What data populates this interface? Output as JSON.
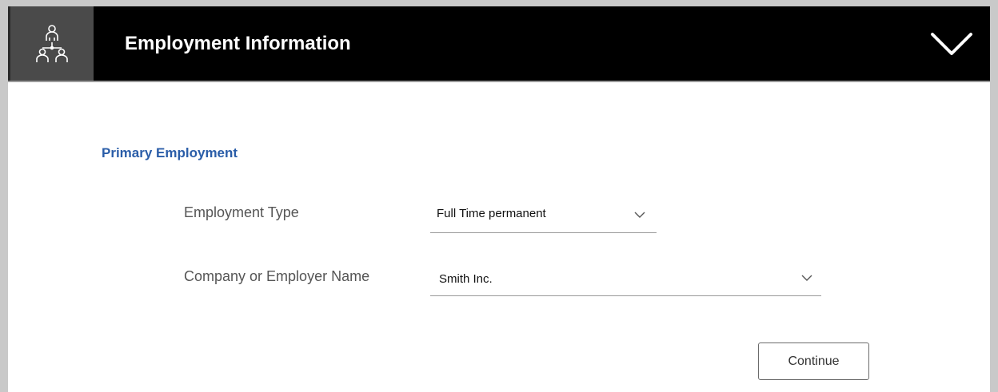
{
  "header": {
    "icon": "org-chart-icon",
    "title": "Employment Information",
    "toggle_icon": "chevron-down-icon"
  },
  "section": {
    "title": "Primary Employment"
  },
  "fields": {
    "employment_type": {
      "label": "Employment Type",
      "value": "Full Time permanent"
    },
    "employer_name": {
      "label": "Company or Employer Name",
      "value": "Smith Inc."
    }
  },
  "actions": {
    "continue_label": "Continue"
  },
  "colors": {
    "header_bg": "#000000",
    "icon_box_bg": "#4a4a4a",
    "section_title": "#2a5da8",
    "frame": "#c9c9c9"
  }
}
